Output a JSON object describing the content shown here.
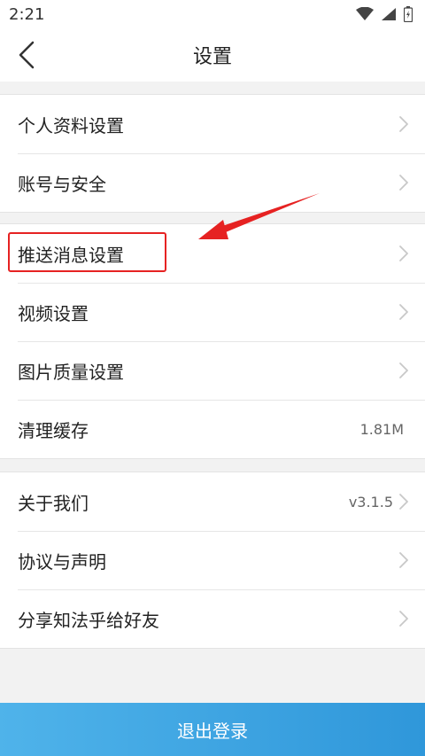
{
  "status_bar": {
    "time": "2:21"
  },
  "header": {
    "title": "设置"
  },
  "groups": [
    {
      "items": [
        {
          "label": "个人资料设置"
        },
        {
          "label": "账号与安全"
        }
      ]
    },
    {
      "items": [
        {
          "label": "推送消息设置"
        },
        {
          "label": "视频设置"
        },
        {
          "label": "图片质量设置"
        },
        {
          "label": "清理缓存",
          "value": "1.81M"
        }
      ]
    },
    {
      "items": [
        {
          "label": "关于我们",
          "value": "v3.1.5"
        },
        {
          "label": "协议与声明"
        },
        {
          "label": "分享知法乎给好友"
        }
      ]
    }
  ],
  "logout": {
    "label": "退出登录"
  },
  "colors": {
    "accent_start": "#4fb3ea",
    "accent_end": "#2f97da",
    "annotation": "#e62222",
    "background": "#f2f2f2"
  }
}
